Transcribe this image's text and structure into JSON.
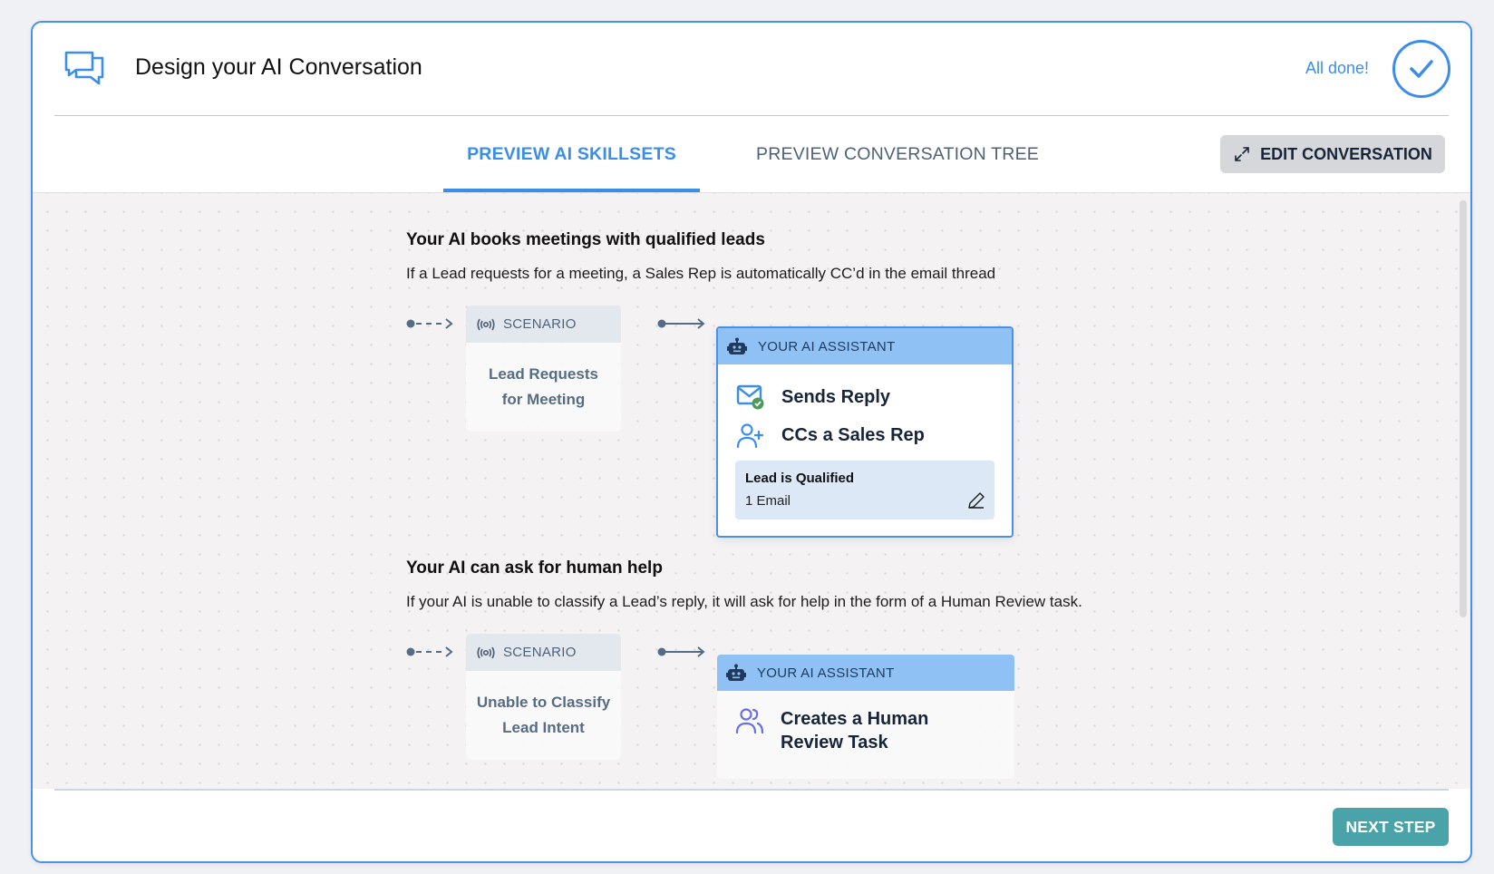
{
  "header": {
    "title": "Design your AI Conversation",
    "status_text": "All done!",
    "chat_icon": "chat-bubbles-icon",
    "status_icon": "check-circle-icon"
  },
  "tabs": [
    {
      "label": "PREVIEW AI SKILLSETS",
      "active": true
    },
    {
      "label": "PREVIEW CONVERSATION TREE",
      "active": false
    }
  ],
  "edit_button": {
    "label": "EDIT CONVERSATION",
    "icon": "expand-icon"
  },
  "sections": [
    {
      "title": "Your AI books meetings with qualified leads",
      "description": "If a Lead requests for a meeting, a Sales Rep is automatically CC’d in the email thread",
      "scenario": {
        "header": "SCENARIO",
        "icon": "broadcast-icon",
        "text_line1": "Lead Requests",
        "text_line2": "for Meeting"
      },
      "assistant": {
        "header": "YOUR AI ASSISTANT",
        "icon": "robot-icon",
        "actions": [
          {
            "label": "Sends Reply",
            "icon": "mail-check-icon"
          },
          {
            "label": "CCs a Sales Rep",
            "icon": "user-plus-icon"
          }
        ],
        "condition": {
          "title": "Lead is Qualified",
          "subtitle": "1 Email",
          "icon": "pencil-icon"
        }
      }
    },
    {
      "title": "Your AI can ask for human help",
      "description": "If your AI is unable to classify a Lead’s reply, it will ask for help in the form of a Human Review task.",
      "scenario": {
        "header": "SCENARIO",
        "icon": "broadcast-icon",
        "text_line1": "Unable to Classify",
        "text_line2": "Lead Intent"
      },
      "assistant": {
        "header": "YOUR AI ASSISTANT",
        "icon": "robot-icon",
        "actions": [
          {
            "label_line1": "Creates a Human",
            "label_line2": "Review Task",
            "icon": "users-icon"
          }
        ]
      }
    }
  ],
  "footer": {
    "next_label": "NEXT STEP"
  },
  "colors": {
    "accent": "#3b8ee8",
    "next_button": "#4aa3a8",
    "assistant_header": "#8fc1f5",
    "scenario_header": "#e3e8ef"
  }
}
